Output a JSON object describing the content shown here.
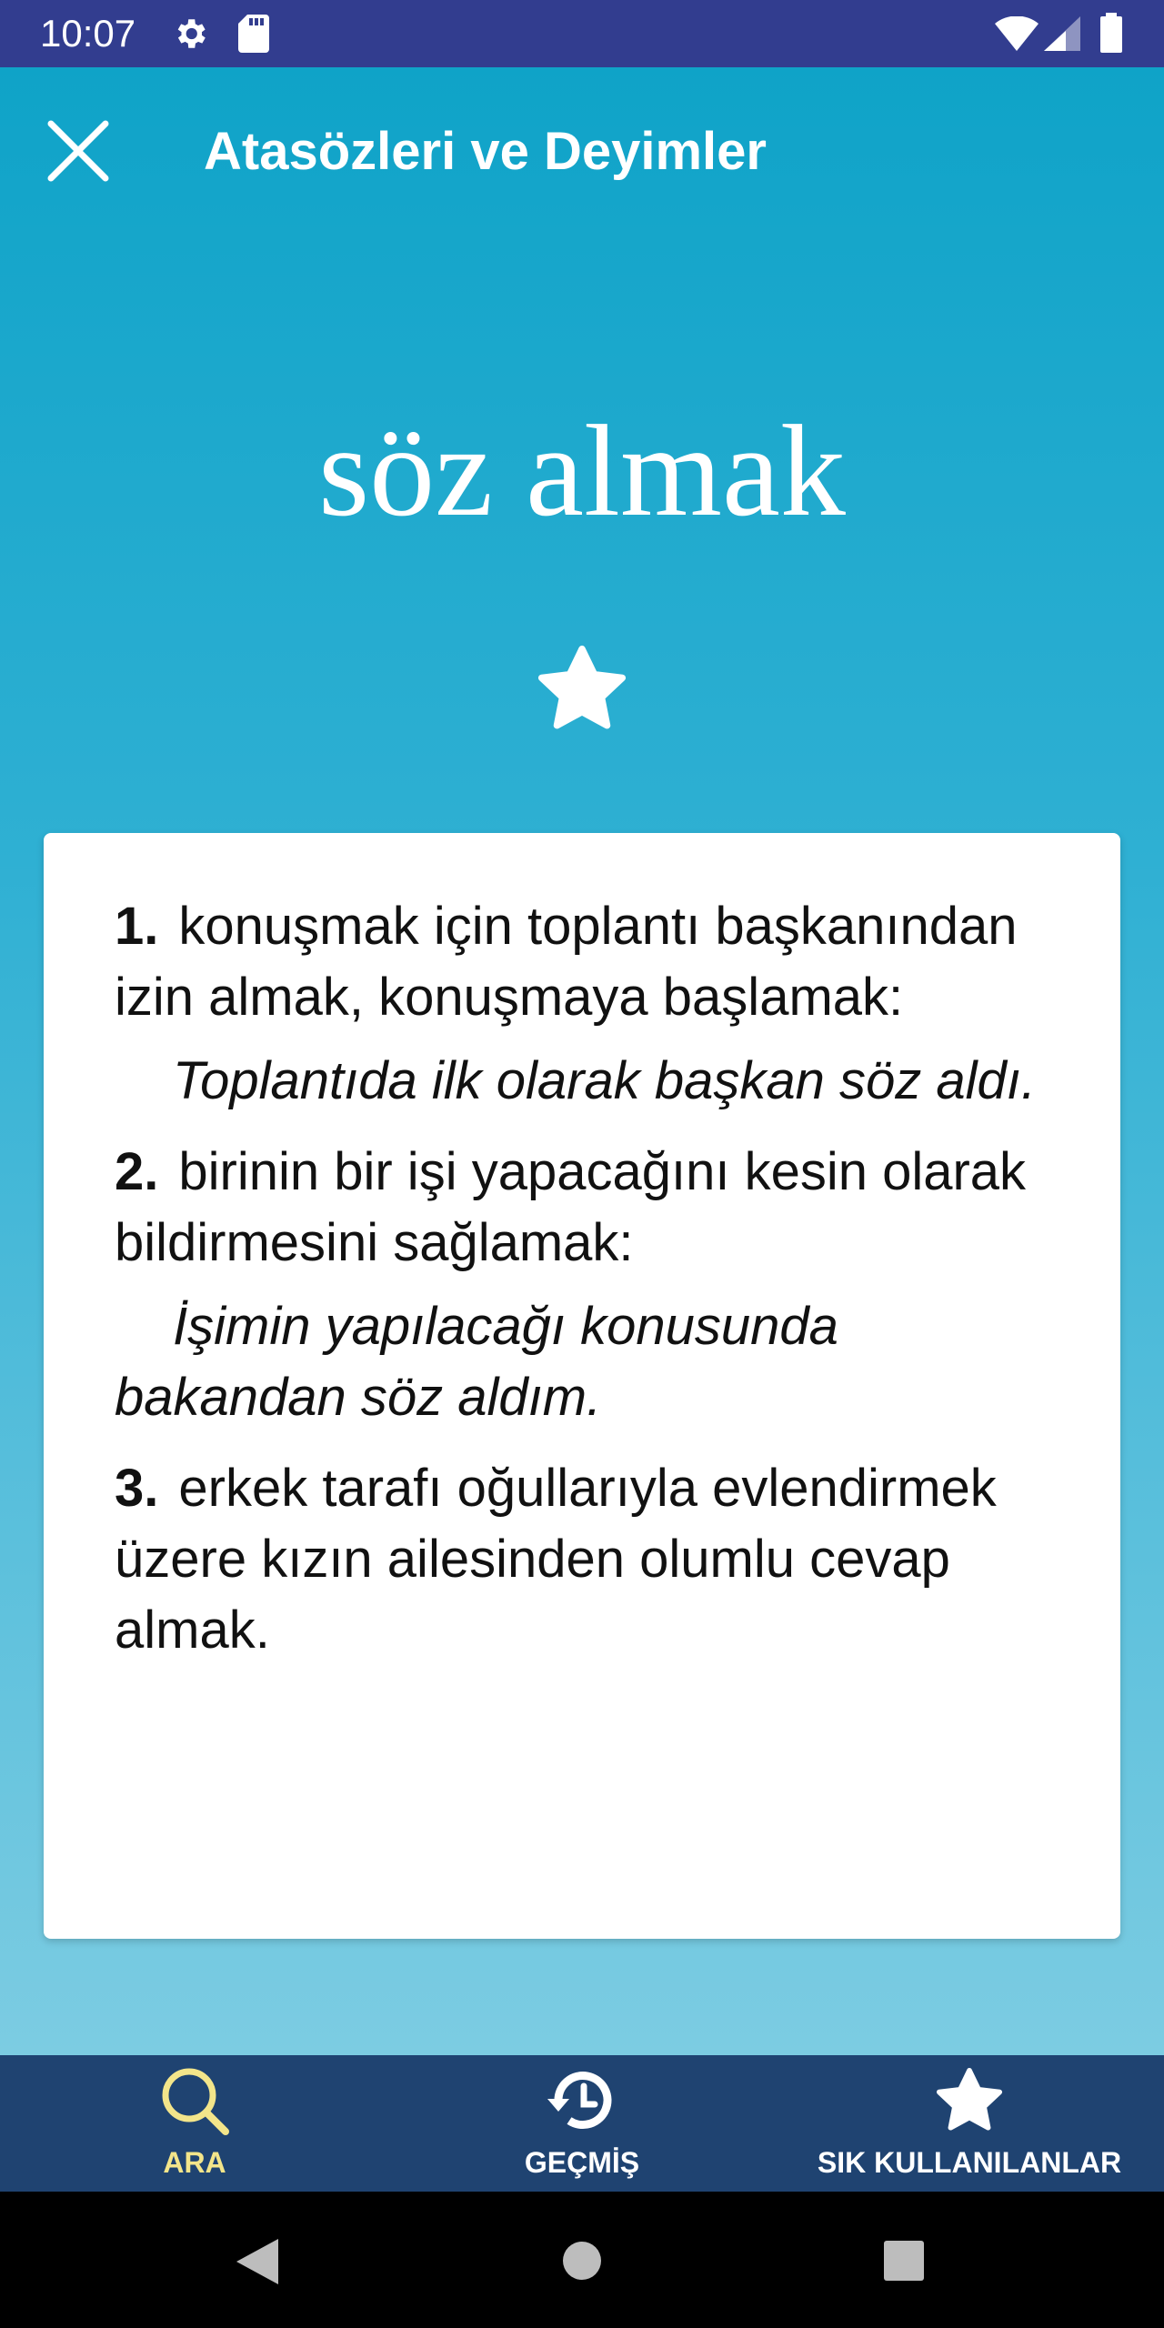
{
  "status_bar": {
    "time": "10:07",
    "icons": [
      "settings-icon",
      "sd-card-icon",
      "wifi-icon",
      "signal-icon",
      "battery-icon"
    ]
  },
  "header": {
    "title": "Atasözleri ve Deyimler",
    "close_icon": "close-icon"
  },
  "entry": {
    "headword": "söz almak",
    "favorite_icon": "star-icon",
    "definitions": [
      {
        "number": "1.",
        "text": "konuşmak için toplantı başkanından izin almak, konuşmaya başlamak:",
        "example": "Toplantıda ilk olarak başkan söz aldı."
      },
      {
        "number": "2.",
        "text": "birinin bir işi yapacağını kesin olarak bildirmesini sağlamak:",
        "example": "İşimin yapılacağı konusunda bakandan söz aldım."
      },
      {
        "number": "3.",
        "text": "erkek tarafı oğullarıyla evlendirmek üzere kızın ailesinden olumlu cevap almak.",
        "example": ""
      }
    ]
  },
  "bottom_nav": {
    "items": [
      {
        "label": "ARA",
        "icon": "search-icon",
        "active": true
      },
      {
        "label": "GEÇMİŞ",
        "icon": "history-icon",
        "active": false
      },
      {
        "label": "SIK KULLANILANLAR",
        "icon": "star-icon",
        "active": false
      }
    ]
  },
  "colors": {
    "status_bar": "#323d8f",
    "gradient_top": "#0fa3c8",
    "gradient_bottom": "#7ccce2",
    "bottom_nav": "#1f4371",
    "active_nav": "#f3e58a",
    "inactive_nav": "#ffffff"
  },
  "system_nav": {
    "buttons": [
      "back-icon",
      "home-icon",
      "recents-icon"
    ]
  }
}
